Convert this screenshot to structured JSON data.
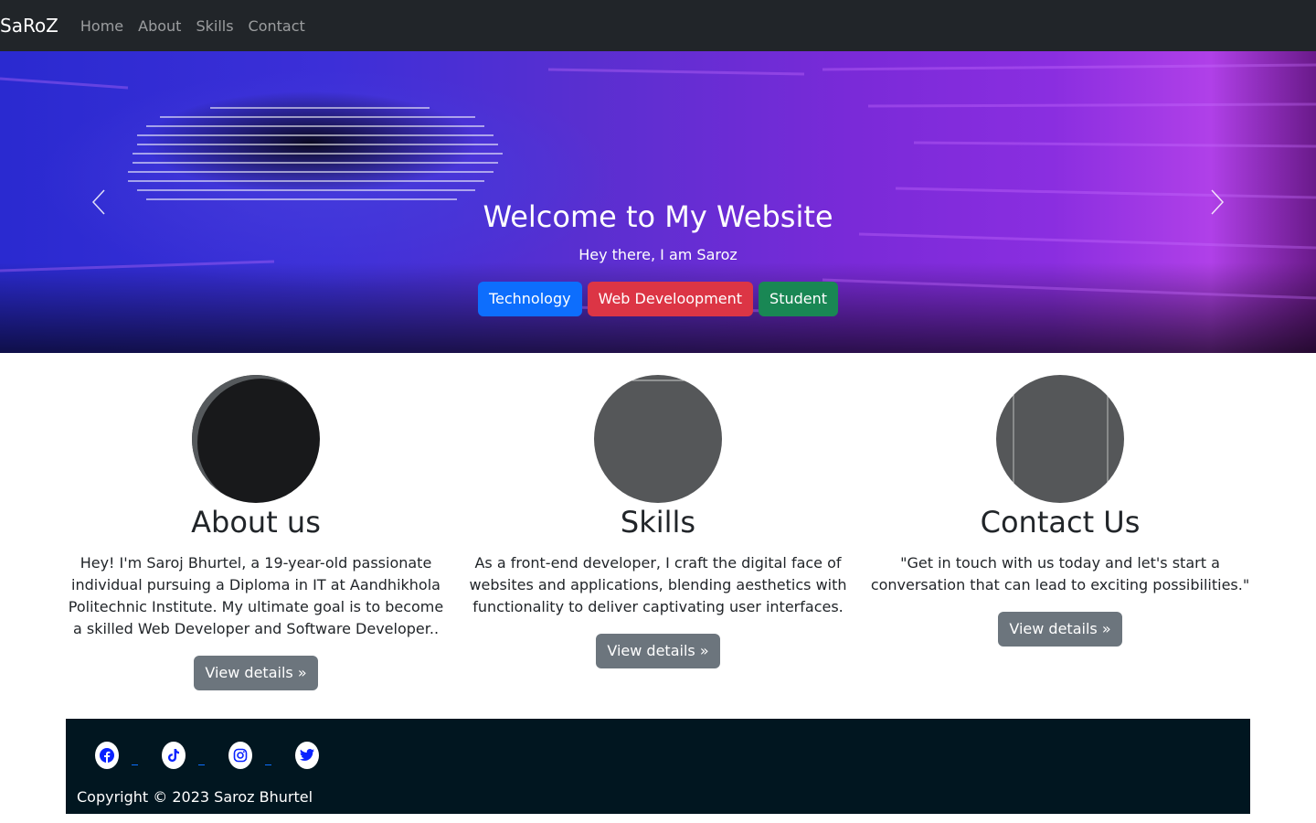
{
  "navbar": {
    "brand": "SaRoZ",
    "links": [
      "Home",
      "About",
      "Skills",
      "Contact"
    ]
  },
  "hero": {
    "title": "Welcome to My Website",
    "subtitle": "Hey there, I am Saroz",
    "buttons": [
      "Technology",
      "Web Develoopment",
      "Student"
    ],
    "prev_icon": "chevron-left-icon",
    "next_icon": "chevron-right-icon"
  },
  "features": [
    {
      "title": "About us",
      "text": "Hey! I'm Saroj Bhurtel, a 19-year-old passionate individual pursuing a Diploma in IT at Aandhikhola Politechnic Institute. My ultimate goal is to become a skilled Web Developer and Software Developer..",
      "button": "View details »"
    },
    {
      "title": "Skills",
      "text": "As a front-end developer, I craft the digital face of websites and applications, blending aesthetics with functionality to deliver captivating user interfaces.",
      "button": "View details »"
    },
    {
      "title": "Contact Us",
      "text": "\"Get in touch with us today and let's start a conversation that can lead to exciting possibilities.\"",
      "button": "View details »"
    }
  ],
  "footer": {
    "social_icons": [
      "facebook-icon",
      "tiktok-icon",
      "instagram-icon",
      "twitter-icon"
    ],
    "copyright": "Copyright © 2023 Saroz Bhurtel"
  },
  "colors": {
    "navbar_bg": "#212529",
    "primary": "#0d6efd",
    "danger": "#dc3545",
    "success": "#198754",
    "secondary": "#6c757d",
    "footer_bg": "#011620"
  }
}
